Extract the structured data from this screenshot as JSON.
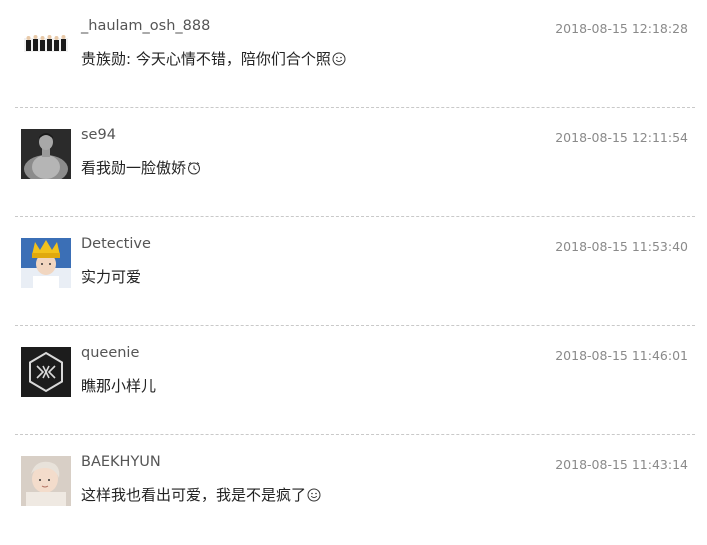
{
  "comments": [
    {
      "username": "_haulam_osh_888",
      "timestamp": "2018-08-15 12:18:28",
      "text": "贵族勋: 今天心情不错，陪你们合个照",
      "emoji": "smile-emoji"
    },
    {
      "username": "se94",
      "timestamp": "2018-08-15 12:11:54",
      "text": "看我勋一脸傲娇",
      "emoji": "clock-emoji"
    },
    {
      "username": "Detective",
      "timestamp": "2018-08-15 11:53:40",
      "text": "实力可爱"
    },
    {
      "username": "queenie",
      "timestamp": "2018-08-15 11:46:01",
      "text": "瞧那小样儿"
    },
    {
      "username": "BAEKHYUN",
      "timestamp": "2018-08-15 11:43:14",
      "text": "这样我也看出可爱，我是不是疯了",
      "emoji": "smile-emoji"
    }
  ],
  "colors": {
    "username": "#555555",
    "timestamp": "#8a8a8a",
    "text": "#222222",
    "divider": "#c9c9c9"
  }
}
